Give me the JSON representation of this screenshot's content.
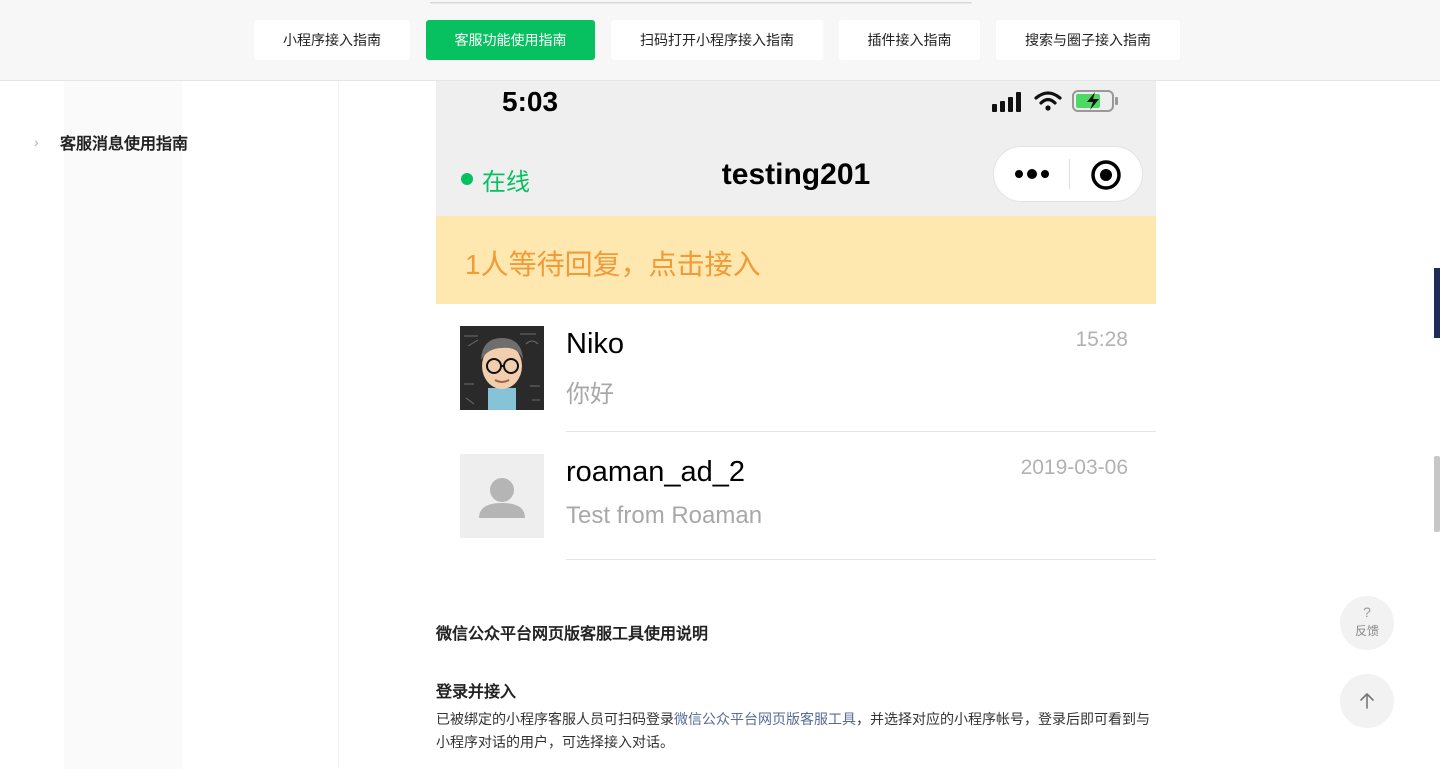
{
  "top_tabs": [
    {
      "label": "小程序接入指南",
      "active": false
    },
    {
      "label": "客服功能使用指南",
      "active": true
    },
    {
      "label": "扫码打开小程序接入指南",
      "active": false
    },
    {
      "label": "插件接入指南",
      "active": false
    },
    {
      "label": "搜索与圈子接入指南",
      "active": false
    }
  ],
  "sidebar": {
    "items": [
      {
        "label": "客服消息使用指南"
      }
    ]
  },
  "phone": {
    "time": "5:03",
    "online": "在线",
    "title": "testing201",
    "banner": "1人等待回复，点击接入",
    "chats": [
      {
        "name": "Niko",
        "message": "你好",
        "time": "15:28"
      },
      {
        "name": "roaman_ad_2",
        "message": "Test from Roaman",
        "time": "2019-03-06"
      }
    ]
  },
  "article": {
    "heading": "微信公众平台网页版客服工具使用说明",
    "subheading": "登录并接入",
    "para_before": "已被绑定的小程序客服人员可扫码登录",
    "para_link": "微信公众平台网页版客服工具",
    "para_after": "，并选择对应的小程序帐号，登录后即可看到与小程序对话的用户，可选择接入对话。"
  },
  "feedback": {
    "icon": "?",
    "label": "反馈"
  },
  "colors": {
    "accent": "#07c160",
    "banner_bg": "#ffe8b0",
    "banner_text": "#f19a38",
    "link": "#576b95"
  }
}
